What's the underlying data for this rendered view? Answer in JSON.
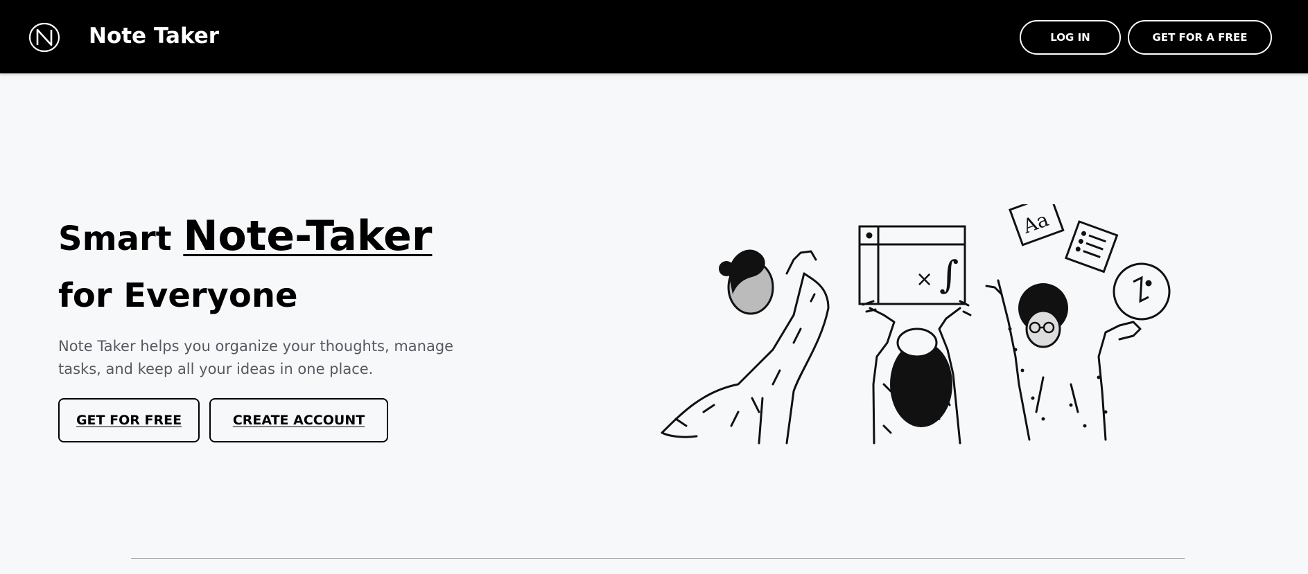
{
  "header": {
    "brand": "Note Taker",
    "login_label": "LOG IN",
    "get_free_label": "GET FOR A FREE"
  },
  "hero": {
    "title_prefix": "Smart",
    "title_highlight": "Note-Taker",
    "title_line2": "for Everyone",
    "description": "Note Taker helps you organize your thoughts, manage tasks, and keep all your ideas in one place.",
    "primary_cta": "GET FOR FREE",
    "secondary_cta": "CREATE ACCOUNT"
  },
  "illustration": {
    "letter_card": "Aa",
    "board_symbols": [
      "×",
      "∫"
    ]
  },
  "colors": {
    "header_bg": "#000000",
    "page_bg": "#f7f8fa",
    "text_muted": "#555a60"
  }
}
